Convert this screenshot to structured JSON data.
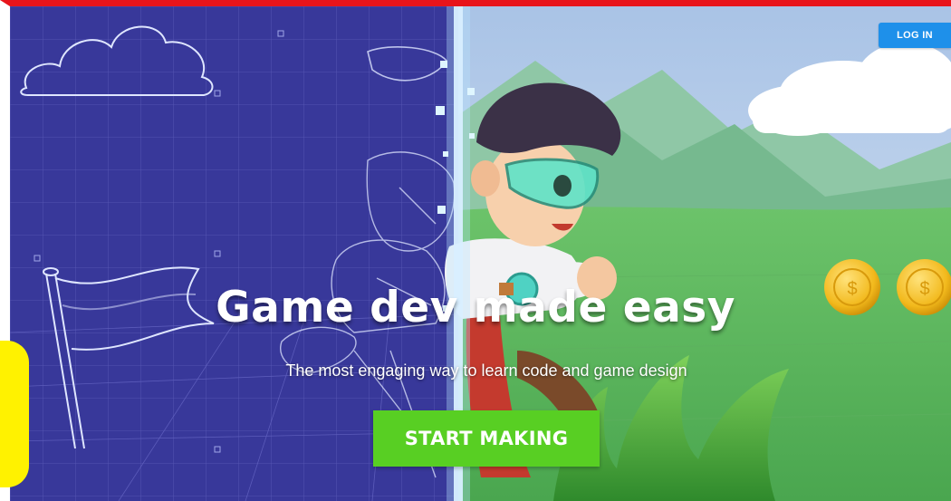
{
  "header": {
    "login_label": "LOG IN"
  },
  "hero": {
    "title": "Game dev made easy",
    "subtitle": "The most engaging way to learn code and game design",
    "cta_label": "START MAKING"
  },
  "colors": {
    "top_bar": "#e8141b",
    "blueprint_bg": "#3a3a9e",
    "sky": "#c7d7ee",
    "grass": "#5bb85e",
    "login_button": "#1e90ea",
    "cta_button": "#58cf23",
    "side_tab": "#fff200"
  },
  "icons": [
    "cloud-sketch",
    "flag-sketch",
    "coin-icon",
    "hero-character"
  ]
}
